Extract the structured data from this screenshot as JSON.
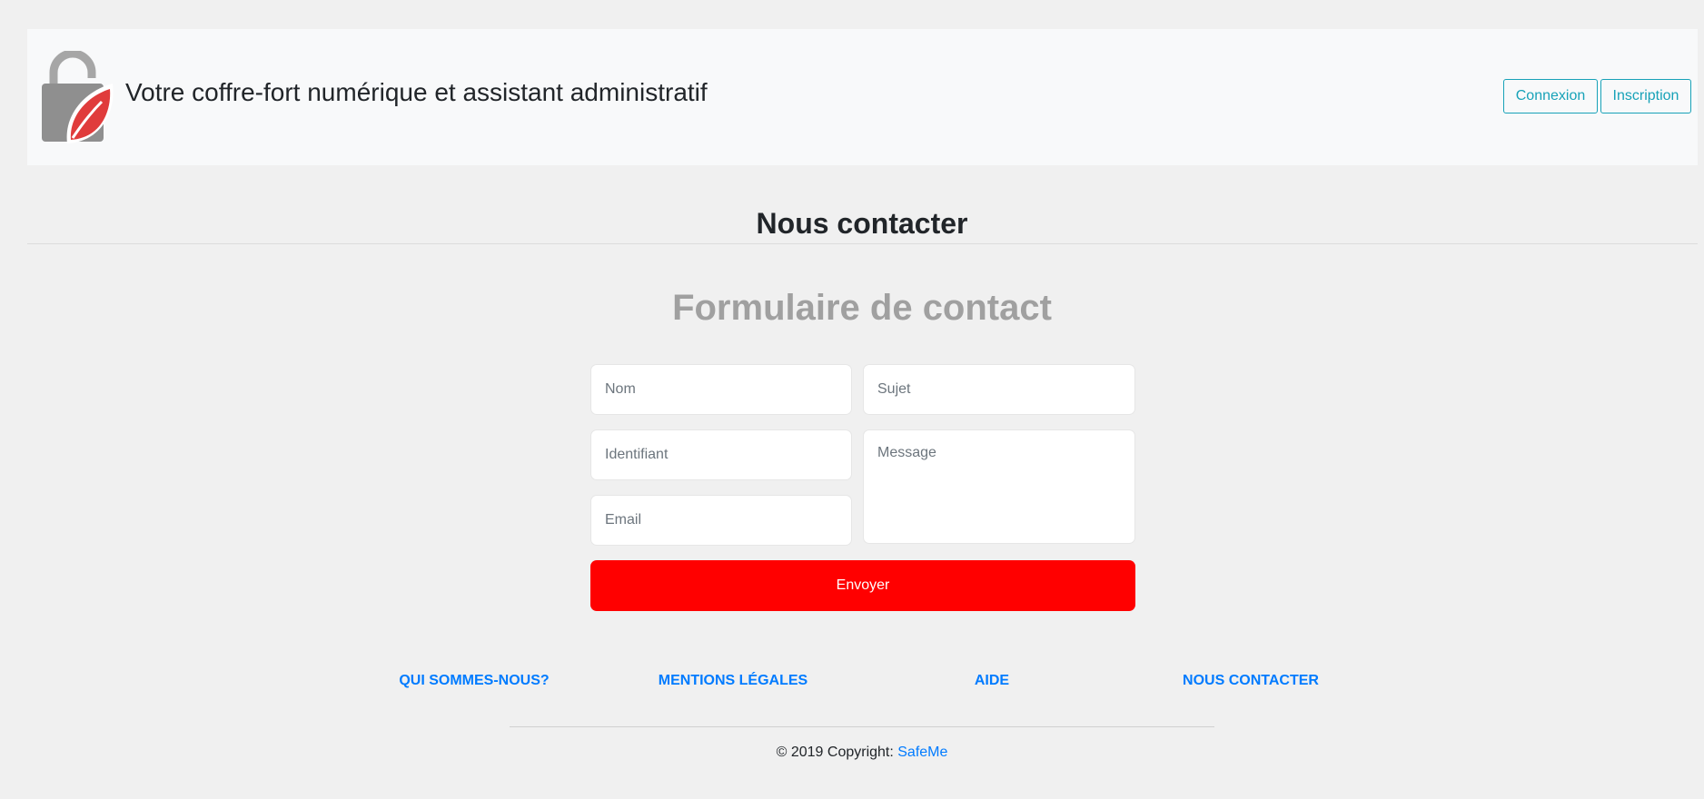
{
  "header": {
    "tagline": "Votre coffre-fort numérique et assistant administratif",
    "login_label": "Connexion",
    "signup_label": "Inscription"
  },
  "main": {
    "page_title": "Nous contacter",
    "form_title": "Formulaire de contact",
    "fields": {
      "nom_placeholder": "Nom",
      "identifiant_placeholder": "Identifiant",
      "email_placeholder": "Email",
      "sujet_placeholder": "Sujet",
      "message_placeholder": "Message"
    },
    "submit_label": "Envoyer"
  },
  "footer": {
    "links": [
      "QUI SOMMES-NOUS?",
      "MENTIONS LÉGALES",
      "AIDE",
      "NOUS CONTACTER"
    ],
    "copyright_prefix": "© 2019 Copyright: ",
    "copyright_link": "SafeMe"
  },
  "colors": {
    "accent": "#17a2b8",
    "link": "#007bff",
    "submit": "#ff0000",
    "logo_gray": "#8f8f8f",
    "logo_red": "#e03c3c"
  },
  "icons": {
    "logo": "padlock-leaf-icon"
  }
}
